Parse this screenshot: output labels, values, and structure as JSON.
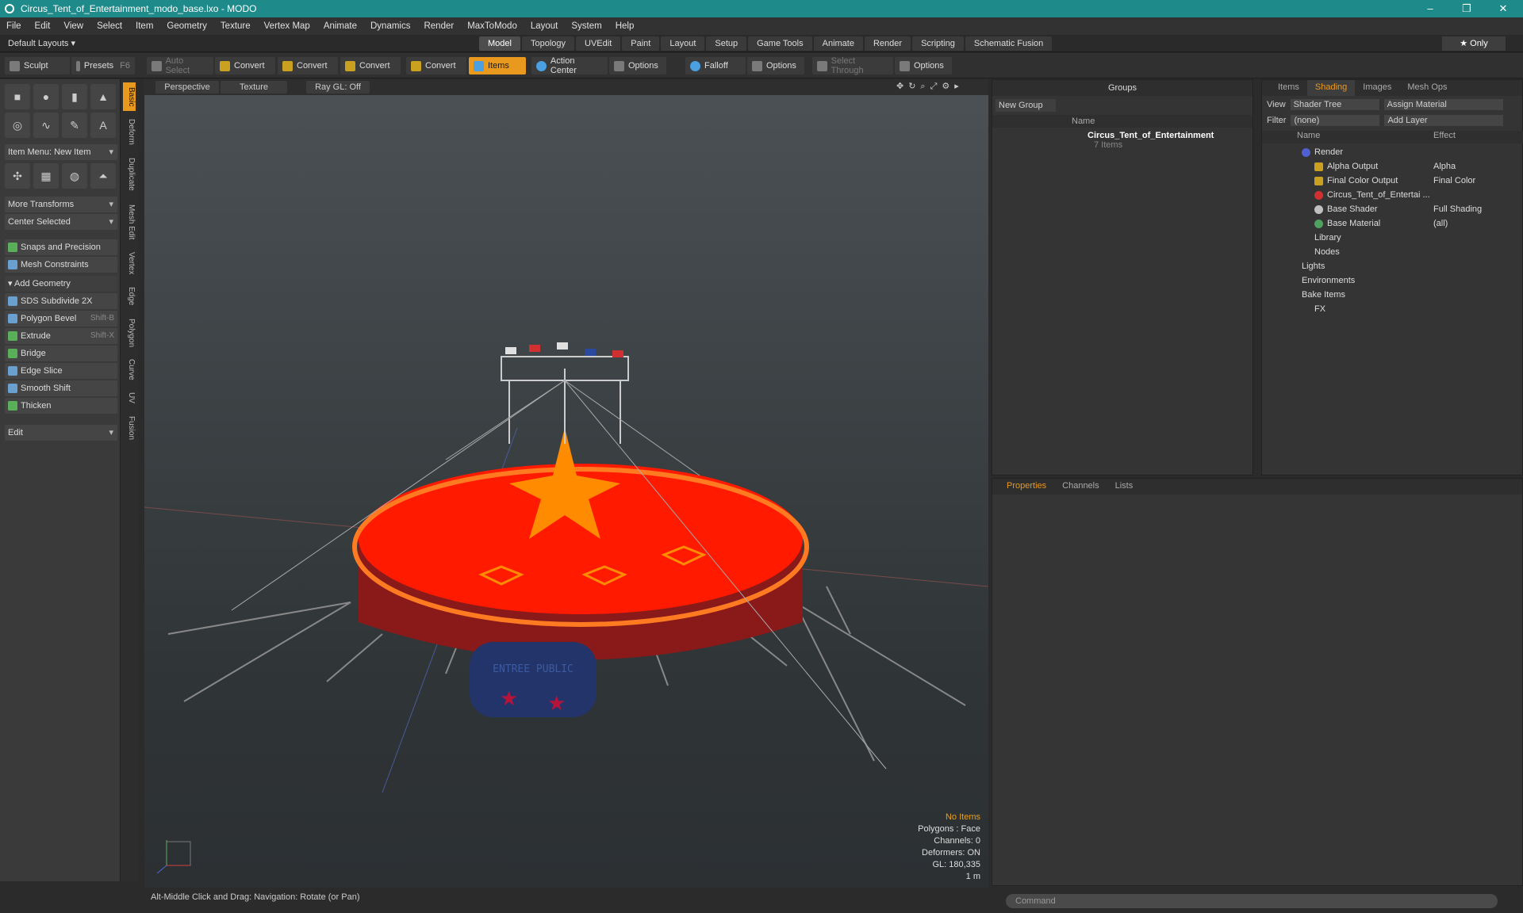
{
  "window": {
    "title": "Circus_Tent_of_Entertainment_modo_base.lxo - MODO",
    "minimize": "–",
    "restore": "❐",
    "close": "✕"
  },
  "menu": [
    "File",
    "Edit",
    "View",
    "Select",
    "Item",
    "Geometry",
    "Texture",
    "Vertex Map",
    "Animate",
    "Dynamics",
    "Render",
    "MaxToModo",
    "Layout",
    "System",
    "Help"
  ],
  "layouts": {
    "default": "Default Layouts ▾",
    "tabs": [
      "Model",
      "Topology",
      "UVEdit",
      "Paint",
      "Layout",
      "Setup",
      "Game Tools",
      "Animate",
      "Render",
      "Scripting",
      "Schematic Fusion"
    ],
    "active": "Model",
    "only": "★ Only"
  },
  "toolbar": {
    "sculpt": "Sculpt",
    "presets": "Presets",
    "presets_key": "F6",
    "auto_select": "Auto Select",
    "convert1": "Convert",
    "convert2": "Convert",
    "convert3": "Convert",
    "convert4": "Convert",
    "items": "Items",
    "action_center": "Action Center",
    "options1": "Options",
    "falloff": "Falloff",
    "options2": "Options",
    "select_through": "Select Through",
    "options3": "Options"
  },
  "left": {
    "item_menu": "Item Menu: New Item",
    "more_transforms": "More Transforms",
    "center_selected": "Center Selected",
    "snaps": "Snaps and Precision",
    "mesh_constraints": "Mesh Constraints",
    "add_geometry": "Add Geometry",
    "tools": [
      {
        "label": "SDS Subdivide 2X",
        "key": ""
      },
      {
        "label": "Polygon Bevel",
        "key": "Shift-B"
      },
      {
        "label": "Extrude",
        "key": "Shift-X"
      },
      {
        "label": "Bridge",
        "key": ""
      },
      {
        "label": "Edge Slice",
        "key": ""
      },
      {
        "label": "Smooth Shift",
        "key": ""
      },
      {
        "label": "Thicken",
        "key": ""
      }
    ],
    "edit": "Edit"
  },
  "vtabs": [
    "Basic",
    "Deform",
    "Duplicate",
    "Mesh Edit",
    "Vertex",
    "Edge",
    "Polygon",
    "Curve",
    "UV",
    "Fusion"
  ],
  "viewport": {
    "perspective": "Perspective",
    "texture": "Texture",
    "raygl": "Ray GL: Off",
    "banner": "ENTREE PUBLIC",
    "info": {
      "items": "No Items",
      "polygons": "Polygons : Face",
      "channels": "Channels: 0",
      "deformers": "Deformers: ON",
      "gl": "GL: 180,335",
      "scale": "1 m"
    }
  },
  "status": "Alt-Middle Click and Drag:   Navigation: Rotate (or Pan)",
  "groups": {
    "title": "Groups",
    "new_group": "New Group",
    "col_name": "Name",
    "item_name": "Circus_Tent_of_Entertainment",
    "item_count": "7 Items"
  },
  "shading": {
    "tabs": [
      "Items",
      "Shading",
      "Images",
      "Mesh Ops"
    ],
    "active": "Shading",
    "view_label": "View",
    "view_value": "Shader Tree",
    "assign": "Assign Material",
    "filter_label": "Filter",
    "filter_value": "(none)",
    "add_layer": "Add Layer",
    "col_name": "Name",
    "col_effect": "Effect",
    "rows": [
      {
        "name": "Render",
        "effect": "",
        "color": "#5060d0"
      },
      {
        "name": "Alpha Output",
        "effect": "Alpha",
        "color": "#c9a020"
      },
      {
        "name": "Final Color Output",
        "effect": "Final Color",
        "color": "#c9a020"
      },
      {
        "name": "Circus_Tent_of_Entertai ...",
        "effect": "",
        "color": "#d03030"
      },
      {
        "name": "Base Shader",
        "effect": "Full Shading",
        "color": "#c0c0c0"
      },
      {
        "name": "Base Material",
        "effect": "(all)",
        "color": "#50a060"
      },
      {
        "name": "Library",
        "effect": "",
        "color": ""
      },
      {
        "name": "Nodes",
        "effect": "",
        "color": ""
      },
      {
        "name": "Lights",
        "effect": "",
        "color": ""
      },
      {
        "name": "Environments",
        "effect": "",
        "color": ""
      },
      {
        "name": "Bake Items",
        "effect": "",
        "color": ""
      },
      {
        "name": "FX",
        "effect": "",
        "color": ""
      }
    ]
  },
  "properties": {
    "tabs": [
      "Properties",
      "Channels",
      "Lists"
    ],
    "active": "Properties"
  },
  "command": {
    "placeholder": "Command"
  }
}
